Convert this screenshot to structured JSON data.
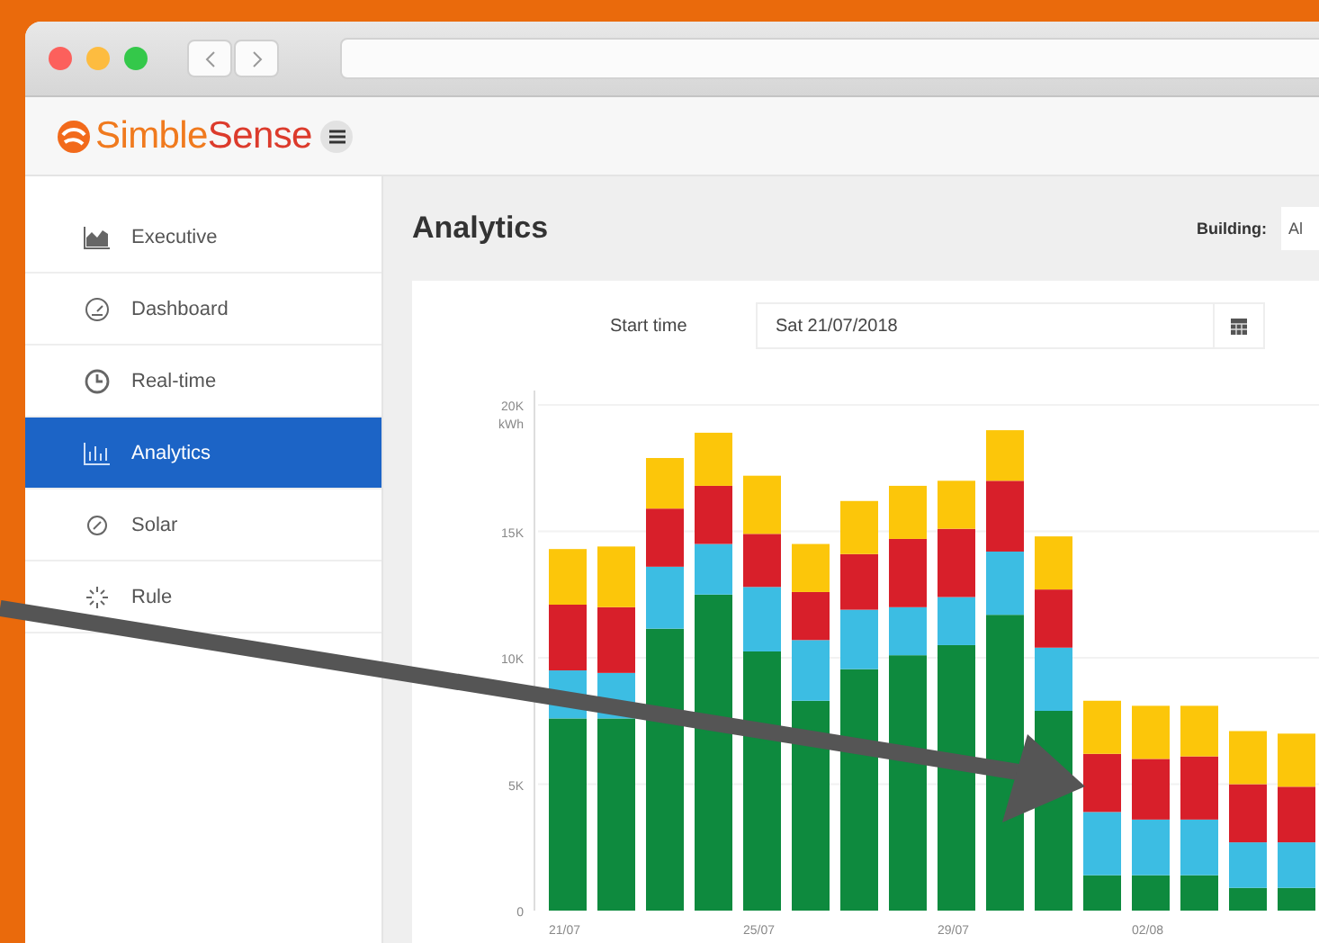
{
  "brand": {
    "first": "Simble",
    "second": "Sense"
  },
  "sidebar": {
    "items": [
      {
        "label": "Executive",
        "selected": false
      },
      {
        "label": "Dashboard",
        "selected": false
      },
      {
        "label": "Real-time",
        "selected": false
      },
      {
        "label": "Analytics",
        "selected": true
      },
      {
        "label": "Solar",
        "selected": false
      },
      {
        "label": "Rule",
        "selected": false
      }
    ]
  },
  "page": {
    "title": "Analytics",
    "building_label": "Building:",
    "building_value": "Al"
  },
  "filter": {
    "label": "Start time",
    "value": "Sat 21/07/2018"
  },
  "chart": {
    "chart_data": {
      "type": "bar",
      "stacked": true,
      "grid": true,
      "ylabel": "kWh",
      "categories": [
        "21/07",
        null,
        null,
        null,
        "25/07",
        null,
        null,
        null,
        "29/07",
        null,
        null,
        null,
        "02/08",
        null,
        null,
        null
      ],
      "ylim": [
        0,
        20000
      ],
      "yticks": [
        {
          "value": 0,
          "label": "0"
        },
        {
          "value": 5000,
          "label": "5K"
        },
        {
          "value": 10000,
          "label": "10K"
        },
        {
          "value": 15000,
          "label": "15K"
        },
        {
          "value": 20000,
          "label": "20K"
        }
      ],
      "series": [
        {
          "color": "#0e8a3e",
          "values": [
            7600,
            7600,
            11150,
            12500,
            10250,
            8300,
            9550,
            10100,
            10500,
            11700,
            7900,
            1400,
            1400,
            1400,
            900,
            900
          ]
        },
        {
          "color": "#3cbde3",
          "values": [
            1900,
            1800,
            2450,
            2000,
            2550,
            2400,
            2350,
            1900,
            1900,
            2500,
            2500,
            2500,
            2200,
            2200,
            1800,
            1800
          ]
        },
        {
          "color": "#d81f2a",
          "values": [
            2600,
            2600,
            2300,
            2300,
            2100,
            1900,
            2200,
            2700,
            2700,
            2800,
            2300,
            2300,
            2400,
            2500,
            2300,
            2200
          ]
        },
        {
          "color": "#fcc60a",
          "values": [
            2200,
            2400,
            2000,
            2100,
            2300,
            1900,
            2100,
            2100,
            1900,
            2000,
            2100,
            2100,
            2100,
            2000,
            2100,
            2100
          ]
        }
      ]
    }
  }
}
